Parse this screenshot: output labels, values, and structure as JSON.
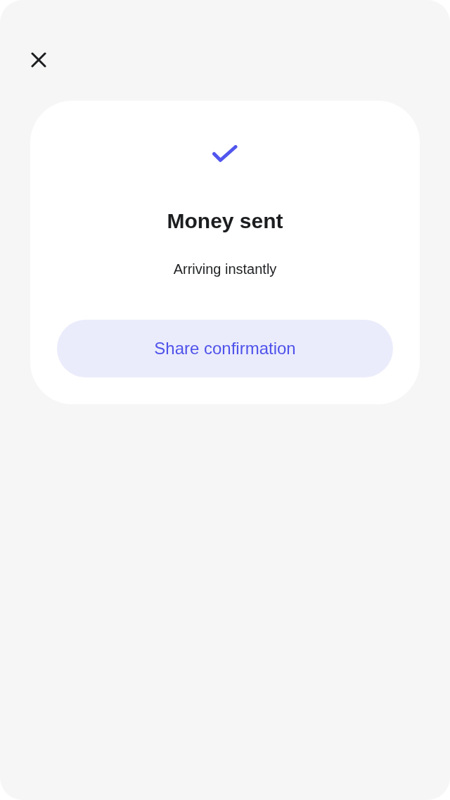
{
  "confirmation": {
    "title": "Money sent",
    "subtitle": "Arriving instantly",
    "action": {
      "label": "Share confirmation"
    }
  }
}
